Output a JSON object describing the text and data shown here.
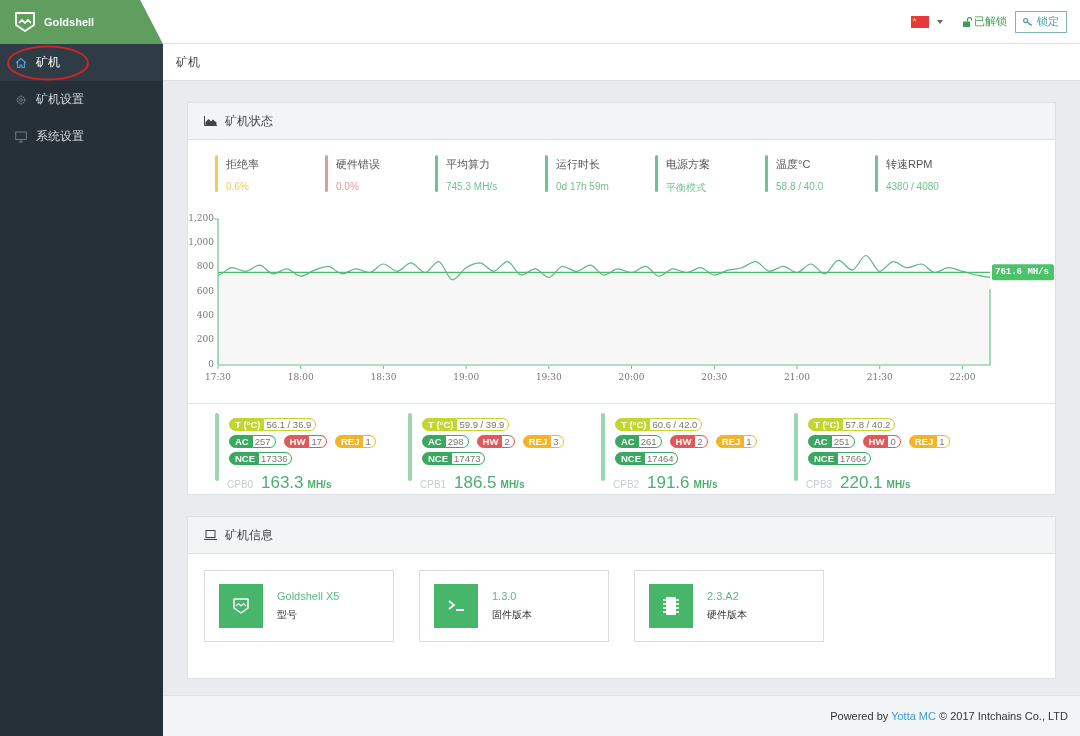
{
  "header": {
    "brand": "Goldshell",
    "unlock_status": "已解锁",
    "lock_button": "锁定"
  },
  "sidebar": {
    "items": [
      {
        "label": "矿机",
        "selected": true,
        "circled": true
      },
      {
        "label": "矿机设置",
        "selected": false,
        "circled": false
      },
      {
        "label": "系统设置",
        "selected": false,
        "circled": false
      }
    ]
  },
  "breadcrumb": "矿机",
  "status_panel": {
    "title": "矿机状态",
    "stats": [
      {
        "label": "拒绝率",
        "value": "0.6%",
        "color": "#f0cd5a"
      },
      {
        "label": "硬件错误",
        "value": "0.0%",
        "color": "#e8979a"
      },
      {
        "label": "平均算力",
        "value": "745.3 MH/s",
        "color": "#6fc291"
      },
      {
        "label": "运行时长",
        "value": "0d 17h 59m",
        "color": "#6fc291"
      },
      {
        "label": "电源方案",
        "value": "平衡模式",
        "color": "#6fc291"
      },
      {
        "label": "温度°C",
        "value": "58.8 / 40.0",
        "color": "#6fc291"
      },
      {
        "label": "转速RPM",
        "value": "4380 / 4080",
        "color": "#6fc291"
      }
    ],
    "chart_data": {
      "type": "line",
      "ylim": [
        0,
        1200
      ],
      "yticks": [
        0,
        200,
        400,
        600,
        800,
        {
          "value": 1000,
          "label": "1,000"
        },
        {
          "value": 1200,
          "label": "1,200"
        }
      ],
      "categories": [
        "17:30",
        null,
        null,
        null,
        null,
        null,
        "18:00",
        null,
        null,
        null,
        null,
        null,
        "18:30",
        null,
        null,
        null,
        null,
        null,
        "19:00",
        null,
        null,
        null,
        null,
        null,
        "19:30",
        null,
        null,
        null,
        null,
        null,
        "20:00",
        null,
        null,
        null,
        null,
        null,
        "20:30",
        null,
        null,
        null,
        null,
        null,
        "21:00",
        null,
        null,
        null,
        null,
        null,
        "21:30",
        null,
        null,
        null,
        null,
        null,
        "22:00",
        null,
        null
      ],
      "series": [
        {
          "color": "#5cb88a",
          "values": [
            740,
            800,
            770,
            820,
            750,
            790,
            730,
            780,
            810,
            750,
            790,
            760,
            830,
            770,
            840,
            760,
            850,
            700,
            800,
            840,
            770,
            850,
            740,
            790,
            720,
            810,
            770,
            820,
            740,
            790,
            760,
            810,
            730,
            790,
            760,
            800,
            740,
            780,
            800,
            850,
            770,
            810,
            760,
            830,
            750,
            860,
            780,
            900,
            770,
            850,
            800,
            830,
            760,
            800,
            770,
            740,
            720
          ]
        }
      ],
      "ref_lines": [
        {
          "axis": "y",
          "value": 761.6,
          "label": "761.6 MH/s"
        }
      ]
    },
    "boards": [
      {
        "name": "CPB0",
        "hashrate": "163.3",
        "unit": "MH/s",
        "badge_rows": [
          [
            {
              "label": "T (°C)",
              "value": "56.1 / 36.9",
              "color": "#c2d62e"
            }
          ],
          [
            {
              "label": "AC",
              "value": "257",
              "color": "#3aa860"
            },
            {
              "label": "HW",
              "value": "17",
              "color": "#e0585a"
            },
            {
              "label": "REJ",
              "value": "1",
              "color": "#f2b52a"
            }
          ],
          [
            {
              "label": "NCE",
              "value": "17336",
              "color": "#3aa860"
            }
          ]
        ]
      },
      {
        "name": "CPB1",
        "hashrate": "186.5",
        "unit": "MH/s",
        "badge_rows": [
          [
            {
              "label": "T (°C)",
              "value": "59.9 / 39.9",
              "color": "#c2d62e"
            }
          ],
          [
            {
              "label": "AC",
              "value": "298",
              "color": "#3aa860"
            },
            {
              "label": "HW",
              "value": "2",
              "color": "#e0585a"
            },
            {
              "label": "REJ",
              "value": "3",
              "color": "#f2b52a"
            }
          ],
          [
            {
              "label": "NCE",
              "value": "17473",
              "color": "#3aa860"
            }
          ]
        ]
      },
      {
        "name": "CPB2",
        "hashrate": "191.6",
        "unit": "MH/s",
        "badge_rows": [
          [
            {
              "label": "T (°C)",
              "value": "60.6 / 42.0",
              "color": "#c2d62e"
            }
          ],
          [
            {
              "label": "AC",
              "value": "261",
              "color": "#3aa860"
            },
            {
              "label": "HW",
              "value": "2",
              "color": "#e0585a"
            },
            {
              "label": "REJ",
              "value": "1",
              "color": "#f2b52a"
            }
          ],
          [
            {
              "label": "NCE",
              "value": "17464",
              "color": "#3aa860"
            }
          ]
        ]
      },
      {
        "name": "CPB3",
        "hashrate": "220.1",
        "unit": "MH/s",
        "badge_rows": [
          [
            {
              "label": "T (°C)",
              "value": "57.8 / 40.2",
              "color": "#c2d62e"
            }
          ],
          [
            {
              "label": "AC",
              "value": "251",
              "color": "#3aa860"
            },
            {
              "label": "HW",
              "value": "0",
              "color": "#e0585a"
            },
            {
              "label": "REJ",
              "value": "1",
              "color": "#f2b52a"
            }
          ],
          [
            {
              "label": "NCE",
              "value": "17664",
              "color": "#3aa860"
            }
          ]
        ]
      }
    ]
  },
  "info_panel": {
    "title": "矿机信息",
    "cards": [
      {
        "value": "Goldshell X5",
        "label": "型号"
      },
      {
        "value": "1.3.0",
        "label": "固件版本"
      },
      {
        "value": "2.3.A2",
        "label": "硬件版本"
      }
    ]
  },
  "footer": {
    "prefix": "Powered by",
    "link": "Yotta MC",
    "suffix": "© 2017 Intchains Co., LTD"
  }
}
